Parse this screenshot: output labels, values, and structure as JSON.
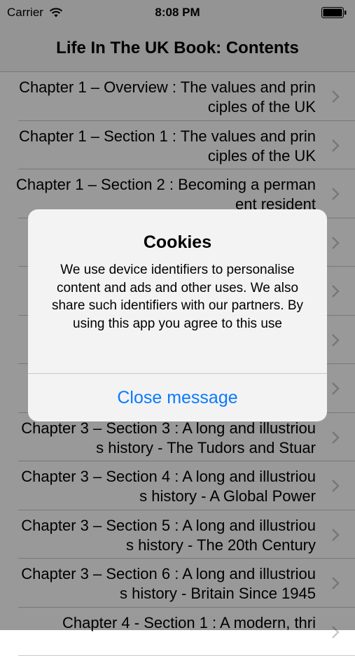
{
  "status_bar": {
    "carrier": "Carrier",
    "time": "8:08 PM"
  },
  "nav": {
    "title": "Life In The UK Book: Contents"
  },
  "rows": [
    "Chapter 1 – Overview : The values and principles of the UK",
    "Chapter 1 – Section 1 : The values and principles of the UK",
    "Chapter 1 – Section 2 : Becoming a permanent resident",
    "",
    "",
    "",
    "",
    "Chapter 3 – Section 3 : A long and illustrious history - The Tudors and Stuar",
    "Chapter 3 – Section 4 : A long and illustrious history - A Global Power",
    "Chapter 3 – Section 5 : A long and illustrious history - The 20th Century",
    "Chapter 3 – Section 6 : A long and illustrious history - Britain Since 1945",
    "Chapter 4 - Section 1 : A modern, thri"
  ],
  "alert": {
    "title": "Cookies",
    "message": "We use device identifiers to personalise content and ads and other uses. We also share such identifiers with our partners. By using this app you agree to this use",
    "button_label": "Close message"
  },
  "colors": {
    "accent": "#0a7aff"
  }
}
